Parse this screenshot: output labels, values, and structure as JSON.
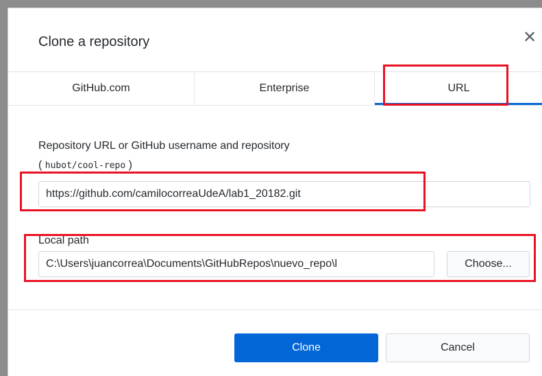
{
  "dialog": {
    "title": "Clone a repository",
    "close_glyph": "✕"
  },
  "tabs": [
    {
      "label": "GitHub.com",
      "selected": false
    },
    {
      "label": "Enterprise",
      "selected": false
    },
    {
      "label": "URL",
      "selected": true
    }
  ],
  "url_section": {
    "label": "Repository URL or GitHub username and repository",
    "hint_open": "( ",
    "hint_code": "hubot/cool-repo",
    "hint_close": " )",
    "value": "https://github.com/camilocorreaUdeA/lab1_20182.git"
  },
  "path_section": {
    "label": "Local path",
    "value": "C:\\Users\\juancorrea\\Documents\\GitHubRepos\\nuevo_repo\\l",
    "choose_label": "Choose..."
  },
  "footer": {
    "clone_label": "Clone",
    "cancel_label": "Cancel"
  },
  "colors": {
    "accent": "#0366d6",
    "highlight": "#e81123"
  }
}
